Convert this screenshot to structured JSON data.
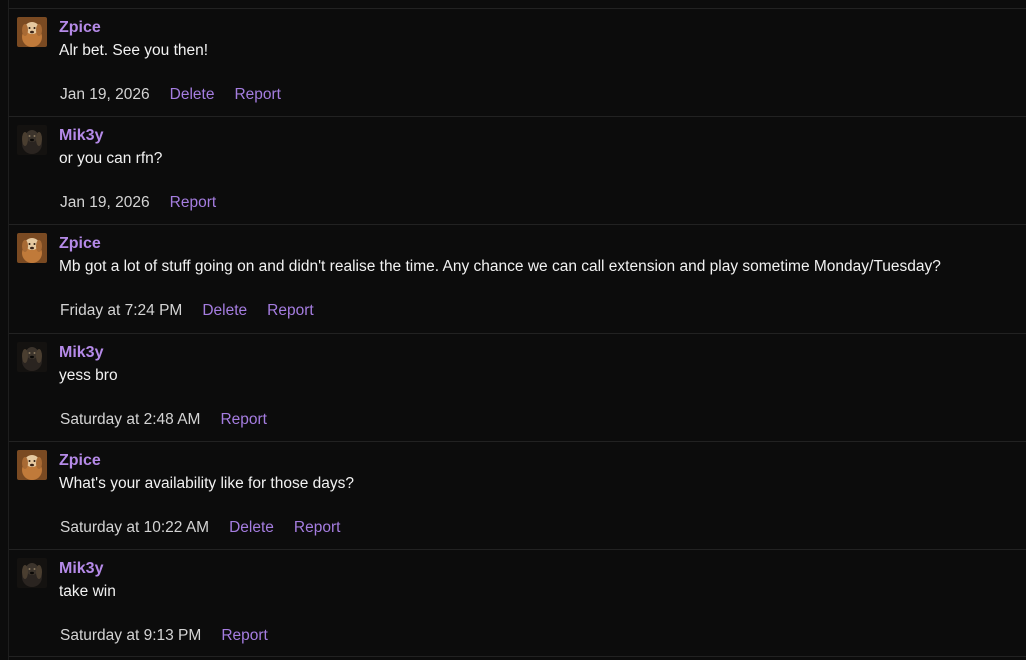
{
  "messages": [
    {
      "author": "Zpice",
      "avatar_icon": "dog-avatar-icon",
      "text": "Alr bet. See you then!",
      "timestamp": "Jan 19, 2026",
      "delete_label": "Delete",
      "report_label": "Report"
    },
    {
      "author": "Mik3y",
      "avatar_icon": "dark-dog-avatar-icon",
      "text": "or you can rfn?",
      "timestamp": "Jan 19, 2026",
      "report_label": "Report"
    },
    {
      "author": "Zpice",
      "avatar_icon": "dog-avatar-icon",
      "text": "Mb got a lot of stuff going on and didn't realise the time. Any chance we can call extension and play sometime Monday/Tuesday?",
      "timestamp": "Friday at 7:24 PM",
      "delete_label": "Delete",
      "report_label": "Report"
    },
    {
      "author": "Mik3y",
      "avatar_icon": "dark-dog-avatar-icon",
      "text": "yess bro",
      "timestamp": "Saturday at 2:48 AM",
      "report_label": "Report"
    },
    {
      "author": "Zpice",
      "avatar_icon": "dog-avatar-icon",
      "text": "What's your availability like for those days?",
      "timestamp": "Saturday at 10:22 AM",
      "delete_label": "Delete",
      "report_label": "Report"
    },
    {
      "author": "Mik3y",
      "avatar_icon": "dark-dog-avatar-icon",
      "text": "take win",
      "timestamp": "Saturday at 9:13 PM",
      "report_label": "Report"
    }
  ],
  "colors": {
    "background": "#0c0c0c",
    "author": "#b58ae8",
    "action_link": "#a57de0",
    "text": "#f2f2f2",
    "timestamp": "#d4d4d4",
    "divider": "#222222"
  }
}
